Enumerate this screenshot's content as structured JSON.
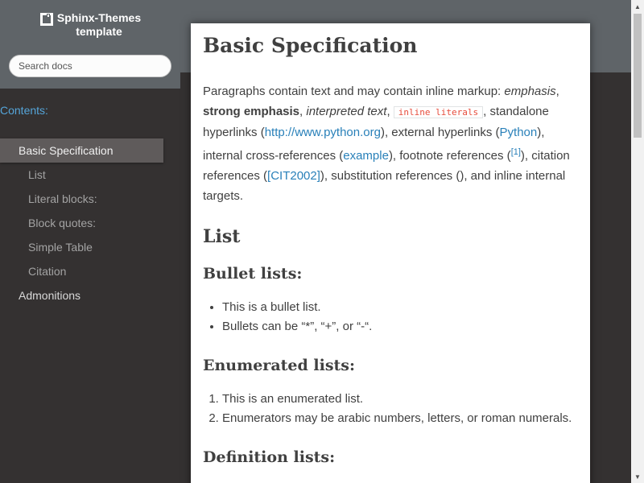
{
  "sidebar": {
    "title_line1": "Sphinx-Themes",
    "title_line2": "template",
    "search_placeholder": "Search docs",
    "contents_caption": "Contents:",
    "toc": [
      {
        "label": "Basic Specification"
      },
      {
        "label": "List"
      },
      {
        "label": "Literal blocks:"
      },
      {
        "label": "Block quotes:"
      },
      {
        "label": "Simple Table"
      },
      {
        "label": "Citation"
      },
      {
        "label": "Admonitions"
      }
    ]
  },
  "content": {
    "title": "Basic Specification",
    "intro": {
      "t1": "Paragraphs contain text and may contain inline markup: ",
      "emphasis": "emphasis",
      "t2": ", ",
      "strong": "strong emphasis",
      "t3": ", ",
      "interpreted": "interpreted text",
      "t4": ", ",
      "literal": "inline literals",
      "t5": ", standalone hyperlinks (",
      "url": "http://www.python.org",
      "t6": "), external hyperlinks (",
      "python": "Python",
      "t7": "), internal cross-references (",
      "example": "example",
      "t8": "), footnote references (",
      "footnote": "[1]",
      "t9": "), citation references (",
      "citation": "[CIT2002]",
      "t10": "), substitution references (), and inline internal targets."
    },
    "list_heading": "List",
    "bullet_heading": "Bullet lists:",
    "bullets": [
      "This is a bullet list.",
      "Bullets can be “*”, “+”, or “-“."
    ],
    "enum_heading": "Enumerated lists:",
    "enums": [
      "This is an enumerated list.",
      "Enumerators may be arabic numbers, letters, or roman numerals."
    ],
    "def_heading": "Definition lists:"
  },
  "colors": {
    "header_bg": "#5f6468",
    "sidebar_bg": "#343131",
    "link": "#2980b9",
    "literal": "#e74c3c",
    "caption": "#55a5d9"
  }
}
